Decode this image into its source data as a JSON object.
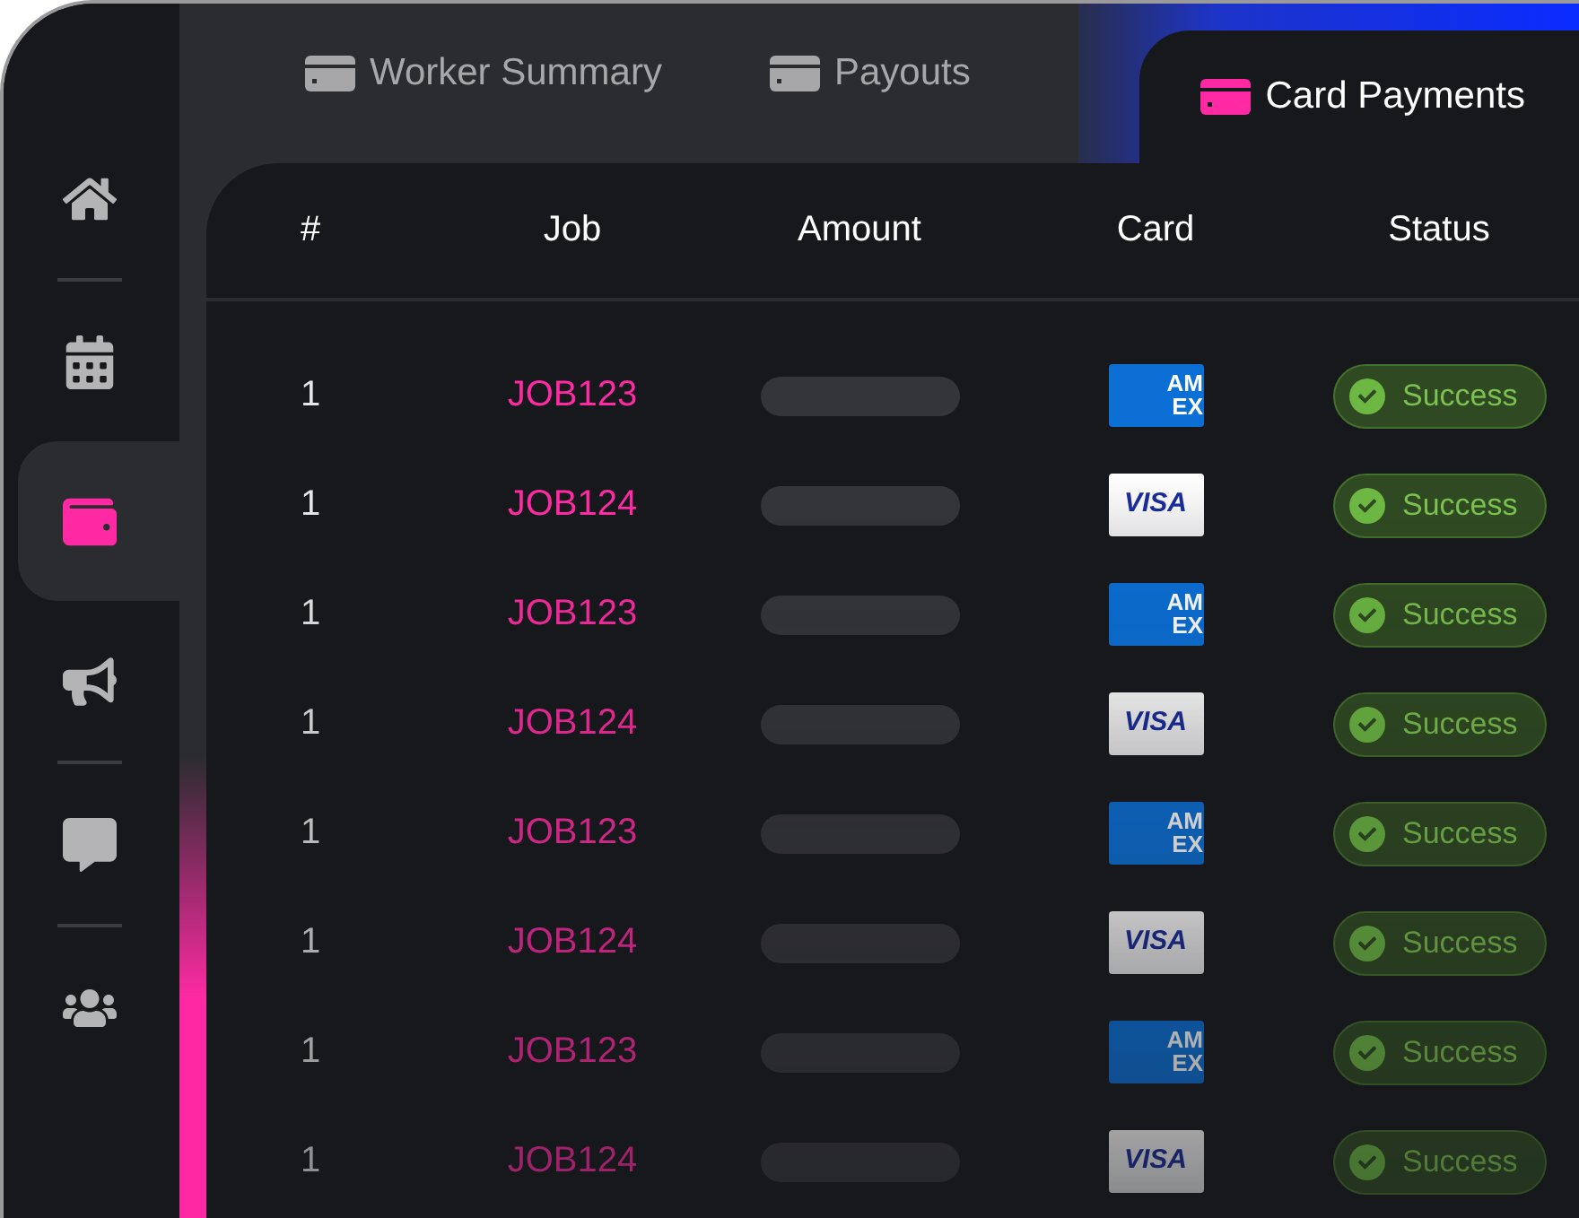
{
  "sidebar": {
    "items": [
      {
        "selected": false
      },
      {
        "selected": false
      },
      {
        "selected": true
      },
      {
        "selected": false
      },
      {
        "selected": false
      },
      {
        "selected": false
      }
    ]
  },
  "tabs": [
    {
      "label": "Worker Summary",
      "selected": false
    },
    {
      "label": "Payouts",
      "selected": false
    },
    {
      "label": "Card Payments",
      "selected": true
    }
  ],
  "table": {
    "columns": [
      "#",
      "Job",
      "Amount",
      "Card",
      "Status"
    ],
    "rows": [
      {
        "number": "1",
        "job": "JOB123",
        "card": {
          "kind": "amex",
          "logo": [
            "AM",
            "EX"
          ]
        },
        "status": {
          "label": "Success",
          "kind": "success"
        }
      },
      {
        "number": "1",
        "job": "JOB124",
        "card": {
          "kind": "visa",
          "logo": [
            "VISA"
          ]
        },
        "status": {
          "label": "Success",
          "kind": "success"
        }
      },
      {
        "number": "1",
        "job": "JOB123",
        "card": {
          "kind": "amex",
          "logo": [
            "AM",
            "EX"
          ]
        },
        "status": {
          "label": "Success",
          "kind": "success"
        }
      },
      {
        "number": "1",
        "job": "JOB124",
        "card": {
          "kind": "visa",
          "logo": [
            "VISA"
          ]
        },
        "status": {
          "label": "Success",
          "kind": "success"
        }
      },
      {
        "number": "1",
        "job": "JOB123",
        "card": {
          "kind": "amex",
          "logo": [
            "AM",
            "EX"
          ]
        },
        "status": {
          "label": "Success",
          "kind": "success"
        }
      },
      {
        "number": "1",
        "job": "JOB124",
        "card": {
          "kind": "visa",
          "logo": [
            "VISA"
          ]
        },
        "status": {
          "label": "Success",
          "kind": "success"
        }
      },
      {
        "number": "1",
        "job": "JOB123",
        "card": {
          "kind": "amex",
          "logo": [
            "AM",
            "EX"
          ]
        },
        "status": {
          "label": "Success",
          "kind": "success"
        }
      },
      {
        "number": "1",
        "job": "JOB124",
        "card": {
          "kind": "visa",
          "logo": [
            "VISA"
          ]
        },
        "status": {
          "label": "Success",
          "kind": "success"
        }
      }
    ]
  }
}
